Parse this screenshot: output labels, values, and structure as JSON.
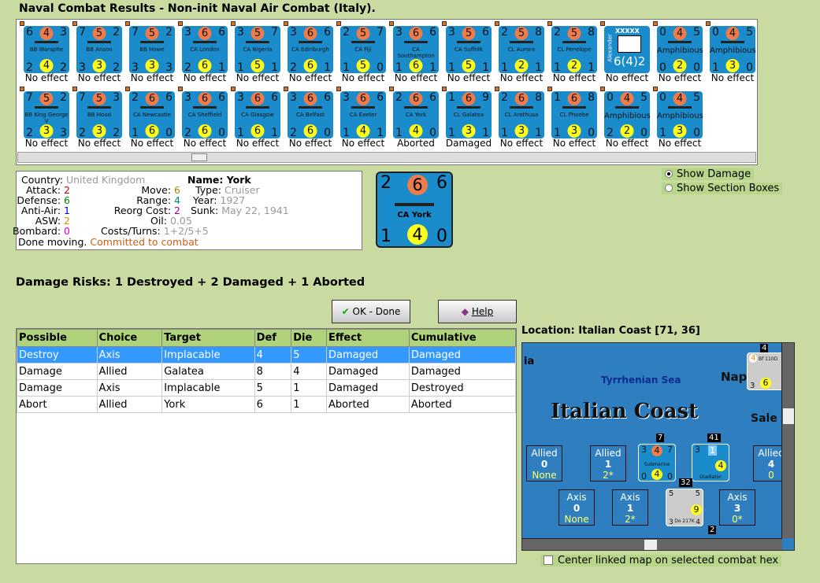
{
  "title": "Naval Combat Results - Non-init Naval Air Combat (Italy).",
  "units_row1": [
    {
      "tl": "6",
      "att": "4",
      "tr": "3",
      "name": "BB Warspite",
      "bl": "2",
      "def": "4",
      "br": "2",
      "result": "No effect"
    },
    {
      "tl": "7",
      "att": "5",
      "tr": "2",
      "name": "BB Anson",
      "bl": "3",
      "def": "3",
      "br": "2",
      "result": "No effect"
    },
    {
      "tl": "7",
      "att": "5",
      "tr": "2",
      "name": "BB Howe",
      "bl": "3",
      "def": "3",
      "br": "3",
      "result": "No effect"
    },
    {
      "tl": "3",
      "att": "6",
      "tr": "6",
      "name": "CA London",
      "bl": "2",
      "def": "6",
      "br": "1",
      "result": "No effect"
    },
    {
      "tl": "3",
      "att": "5",
      "tr": "7",
      "name": "CA Nigeria",
      "bl": "1",
      "def": "5",
      "br": "1",
      "result": "No effect"
    },
    {
      "tl": "3",
      "att": "6",
      "tr": "6",
      "name": "CA Edinburgh",
      "bl": "2",
      "def": "6",
      "br": "1",
      "result": "No effect"
    },
    {
      "tl": "2",
      "att": "5",
      "tr": "7",
      "name": "CA Fiji",
      "bl": "1",
      "def": "5",
      "br": "0",
      "result": "No effect"
    },
    {
      "tl": "3",
      "att": "6",
      "tr": "6",
      "name": "CA Southampton",
      "bl": "1",
      "def": "6",
      "br": "1",
      "result": "No effect"
    },
    {
      "tl": "3",
      "att": "5",
      "tr": "6",
      "name": "CA Suffolk",
      "bl": "1",
      "def": "5",
      "br": "1",
      "result": "No effect"
    },
    {
      "tl": "2",
      "att": "5",
      "tr": "8",
      "name": "CL Aurora",
      "bl": "1",
      "def": "2",
      "br": "1",
      "result": "No effect"
    },
    {
      "tl": "2",
      "att": "5",
      "tr": "8",
      "name": "CL Penelope",
      "bl": "1",
      "def": "2",
      "br": "1",
      "result": "No effect"
    },
    {
      "hq": true,
      "name": "Alexander",
      "rank": "XXXXX",
      "value": "6(4)2",
      "result": "No effect"
    },
    {
      "tl": "0",
      "att": "4",
      "tr": "5",
      "name": "Amphibious",
      "bl": "0",
      "def": "2",
      "br": "0",
      "result": "No effect"
    },
    {
      "tl": "0",
      "att": "4",
      "tr": "5",
      "name": "Amphibious",
      "bl": "1",
      "def": "3",
      "br": "0",
      "result": "No effect"
    }
  ],
  "units_row2": [
    {
      "tl": "7",
      "att": "5",
      "tr": "2",
      "name": "BB King George V",
      "bl": "2",
      "def": "3",
      "br": "3",
      "result": "No effect"
    },
    {
      "tl": "7",
      "att": "5",
      "tr": "3",
      "name": "BB Hood",
      "bl": "2",
      "def": "3",
      "br": "2",
      "result": "No effect"
    },
    {
      "tl": "2",
      "att": "6",
      "tr": "6",
      "name": "CA Newcastle",
      "bl": "1",
      "def": "6",
      "br": "0",
      "result": "No effect"
    },
    {
      "tl": "3",
      "att": "6",
      "tr": "6",
      "name": "CA Sheffield",
      "bl": "2",
      "def": "6",
      "br": "0",
      "result": "No effect"
    },
    {
      "tl": "3",
      "att": "6",
      "tr": "6",
      "name": "CA Glasgow",
      "bl": "1",
      "def": "6",
      "br": "1",
      "result": "No effect"
    },
    {
      "tl": "3",
      "att": "6",
      "tr": "6",
      "name": "CA Belfast",
      "bl": "2",
      "def": "6",
      "br": "0",
      "result": "No effect"
    },
    {
      "tl": "3",
      "att": "6",
      "tr": "6",
      "name": "CA Exeter",
      "bl": "1",
      "def": "4",
      "br": "1",
      "result": "No effect"
    },
    {
      "tl": "2",
      "att": "6",
      "tr": "6",
      "name": "CA York",
      "bl": "1",
      "def": "4",
      "br": "0",
      "result": "Aborted"
    },
    {
      "tl": "1",
      "att": "6",
      "tr": "9",
      "name": "CL Galatea",
      "bl": "1",
      "def": "3",
      "br": "1",
      "result": "Damaged"
    },
    {
      "tl": "2",
      "att": "6",
      "tr": "8",
      "name": "CL Arethusa",
      "bl": "1",
      "def": "3",
      "br": "1",
      "result": "No effect"
    },
    {
      "tl": "1",
      "att": "6",
      "tr": "8",
      "name": "CL Phoebe",
      "bl": "1",
      "def": "3",
      "br": "0",
      "result": "No effect"
    },
    {
      "tl": "0",
      "att": "4",
      "tr": "5",
      "name": "Amphibious",
      "bl": "2",
      "def": "2",
      "br": "0",
      "result": "No effect"
    },
    {
      "tl": "0",
      "att": "4",
      "tr": "5",
      "name": "Amphibious",
      "bl": "1",
      "def": "3",
      "br": "0",
      "result": "No effect"
    }
  ],
  "info": {
    "country_label": "Country:",
    "country": "United Kingdom",
    "attack_label": "Attack:",
    "attack": "2",
    "defense_label": "Defense:",
    "defense": "6",
    "aa_label": "Anti-Air:",
    "aa": "1",
    "asw_label": "ASW:",
    "asw": "2",
    "bombard_label": "Bombard:",
    "bombard": "0",
    "move_label": "Move:",
    "move": "6",
    "range_label": "Range:",
    "range": "4",
    "reorg_label": "Reorg Cost:",
    "reorg": "2",
    "oil_label": "Oil:",
    "oil": "0.05",
    "costs_label": "Costs/Turns:",
    "costs": "1+2/5+5",
    "name_label": "Name: York",
    "type_label": "Type:",
    "type": "Cruiser",
    "year_label": "Year:",
    "year": "1927",
    "sunk_label": "Sunk:",
    "sunk": "May 22, 1941",
    "status": "Done moving.",
    "status2": "Committed to combat"
  },
  "selected_counter": {
    "tl": "2",
    "att": "6",
    "tr": "6",
    "name": "CA York",
    "bl": "1",
    "def": "4",
    "br": "0"
  },
  "options": {
    "show_damage": "Show Damage",
    "show_sections": "Show Section Boxes"
  },
  "damage_risks": "Damage Risks:  1 Destroyed + 2 Damaged + 1 Aborted",
  "buttons": {
    "ok": "OK - Done",
    "help": "Help"
  },
  "table": {
    "headers": [
      "Possible",
      "Choice",
      "Target",
      "Def",
      "Die",
      "Effect",
      "Cumulative"
    ],
    "rows": [
      [
        "Destroy",
        "Axis",
        "Implacable",
        "4",
        "5",
        "Damaged",
        "Damaged"
      ],
      [
        "Damage",
        "Allied",
        "Galatea",
        "8",
        "4",
        "Damaged",
        "Damaged"
      ],
      [
        "Damage",
        "Axis",
        "Implacable",
        "5",
        "1",
        "Damaged",
        "Destroyed"
      ],
      [
        "Abort",
        "Allied",
        "York",
        "6",
        "1",
        "Aborted",
        "Aborted"
      ]
    ]
  },
  "location": "Location:  Italian Coast [71, 36]",
  "map": {
    "sea": "Tyrrhenian Sea",
    "hex": "Italian Coast",
    "city1": "Napl",
    "city2": "Sale",
    "edge": "ia",
    "allied_boxes": [
      {
        "side": "Allied",
        "n": "0",
        "v": "None"
      },
      {
        "side": "Allied",
        "n": "1",
        "v": "2*"
      },
      {
        "side": "Allied",
        "n": "4",
        "v": "0"
      }
    ],
    "axis_boxes": [
      {
        "side": "Axis",
        "n": "0",
        "v": "None"
      },
      {
        "side": "Axis",
        "n": "1",
        "v": "2*"
      },
      {
        "side": "Axis",
        "n": "3",
        "v": "0*"
      }
    ],
    "sub": {
      "tl": "3",
      "att": "4",
      "tr": "7",
      "name": "Submarine",
      "bl": "0",
      "def": "4",
      "br": "0",
      "stack": "7"
    },
    "gladiator": {
      "name": "Gladiator",
      "tl": "3",
      "att": "1",
      "def": "4",
      "stack": "41"
    },
    "do217": {
      "name": "Do 217K",
      "tl": "5",
      "tr": "5",
      "bl": "3",
      "br": "4",
      "def": "9",
      "stack": "32"
    },
    "bf110": {
      "name": "Bf 110D",
      "att": "4",
      "bl": "3",
      "def": "6",
      "stack": "4"
    },
    "stack2": "2"
  },
  "center_checkbox": "Center linked map on selected combat hex"
}
